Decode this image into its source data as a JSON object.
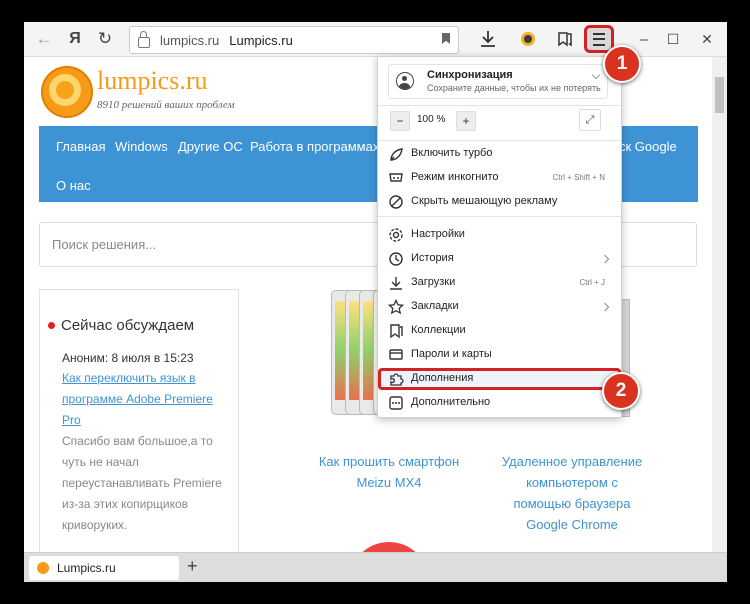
{
  "toolbar": {
    "back_icon": "←",
    "yandex_icon": "Я",
    "reload_icon": "↻",
    "address_domain": "lumpics.ru",
    "address_title": "Lumpics.ru",
    "window_min": "–",
    "window_max": "☐",
    "window_close": "✕"
  },
  "badges": [
    "1",
    "2"
  ],
  "page": {
    "site_name": "lumpics.ru",
    "tagline": "8910 решений ваших проблем",
    "nav": [
      "Главная",
      "Windows",
      "Другие ОС",
      "Работа в программах",
      "ск Google",
      "О нас"
    ],
    "search_placeholder": "Поиск решения...",
    "sidebar": {
      "title": "Сейчас обсуждаем",
      "lines": [
        {
          "text": "Аноним: 8 июля в 15:23",
          "type": "meta"
        },
        {
          "text": "Как переключить язык в",
          "type": "link"
        },
        {
          "text": "программе Adobe Premiere",
          "type": "link"
        },
        {
          "text": "Pro",
          "type": "link"
        },
        {
          "text": "Спасибо вам большое,а то",
          "type": "text"
        },
        {
          "text": "чуть не начал",
          "type": "text"
        },
        {
          "text": "переустанавливать Premiere",
          "type": "text"
        },
        {
          "text": "из-за этих копирщиков",
          "type": "text"
        },
        {
          "text": "криворуких.",
          "type": "text"
        }
      ]
    },
    "article1": [
      "Как прошить смартфон",
      "Meizu MX4"
    ],
    "article2": [
      "Удаленное управление",
      "компьютером с",
      "помощью браузера",
      "Google Chrome"
    ]
  },
  "tabbar": {
    "tab_title": "Lumpics.ru",
    "new_tab": "+"
  },
  "menu": {
    "sync_title": "Синхронизация",
    "sync_sub": "Сохраните данные, чтобы их не потерять",
    "zoom_minus": "−",
    "zoom_value": "100 %",
    "zoom_plus": "+",
    "items": [
      {
        "label": "Включить турбо",
        "icon": "rocket-icon"
      },
      {
        "label": "Режим инкогнито",
        "shortcut": "Ctrl + Shift + N",
        "icon": "incognito-icon"
      },
      {
        "label": "Скрыть мешающую рекламу",
        "icon": "block-icon"
      },
      {
        "label": "Настройки",
        "icon": "gear-icon"
      },
      {
        "label": "История",
        "icon": "clock-icon"
      },
      {
        "label": "Загрузки",
        "shortcut": "Ctrl + J",
        "icon": "download-icon"
      },
      {
        "label": "Закладки",
        "icon": "star-icon"
      },
      {
        "label": "Коллекции",
        "icon": "collection-icon"
      },
      {
        "label": "Пароли и карты",
        "icon": "key-icon"
      },
      {
        "label": "Дополнения",
        "icon": "puzzle-icon"
      },
      {
        "label": "Дополнительно",
        "icon": "more-icon"
      }
    ]
  }
}
